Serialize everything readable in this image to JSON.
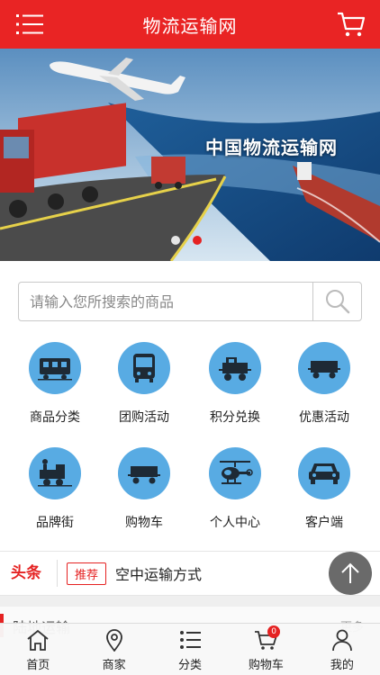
{
  "header": {
    "title": "物流运输网"
  },
  "banner": {
    "caption": "中国物流运输网",
    "dots": [
      {
        "active": false
      },
      {
        "active": true
      }
    ]
  },
  "search": {
    "placeholder": "请输入您所搜索的商品"
  },
  "grid": [
    {
      "label": "商品分类",
      "icon": "tram-icon"
    },
    {
      "label": "团购活动",
      "icon": "bus-icon"
    },
    {
      "label": "积分兑换",
      "icon": "locomotive-icon"
    },
    {
      "label": "优惠活动",
      "icon": "freight-car-icon"
    },
    {
      "label": "品牌街",
      "icon": "steam-train-icon"
    },
    {
      "label": "购物车",
      "icon": "cart-wagon-icon"
    },
    {
      "label": "个人中心",
      "icon": "helicopter-icon"
    },
    {
      "label": "客户端",
      "icon": "car-icon"
    }
  ],
  "news": {
    "tag": "头条",
    "badge": "推荐",
    "text": "空中运输方式"
  },
  "section": {
    "title": "陆地运输",
    "more": "更多"
  },
  "tabbar": [
    {
      "label": "首页",
      "icon": "home-icon"
    },
    {
      "label": "商家",
      "icon": "location-pin-icon"
    },
    {
      "label": "分类",
      "icon": "list-icon"
    },
    {
      "label": "购物车",
      "icon": "cart-icon",
      "badge": "0"
    },
    {
      "label": "我的",
      "icon": "user-icon"
    }
  ],
  "colors": {
    "brand": "#e92424",
    "icon_circle": "#58abe3"
  }
}
